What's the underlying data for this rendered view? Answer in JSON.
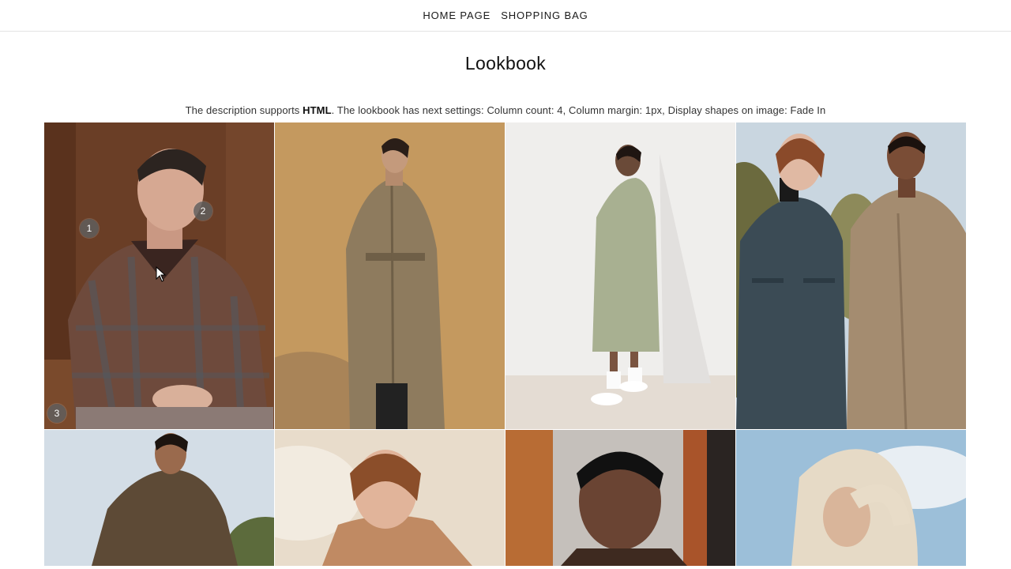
{
  "nav": {
    "home_label": "HOME PAGE",
    "bag_label": "SHOPPING BAG"
  },
  "page": {
    "title": "Lookbook",
    "description_pre": "The description supports ",
    "description_bold": "HTML",
    "description_post": ". The lookbook has next settings: Column count: 4, Column margin: 1px, Display shapes on image: Fade In"
  },
  "lookbook": {
    "hotspots": [
      "1",
      "2",
      "3"
    ]
  },
  "colors": {
    "nav_border": "#e3e3e3",
    "hotspot_bg": "#5f5f5f"
  }
}
